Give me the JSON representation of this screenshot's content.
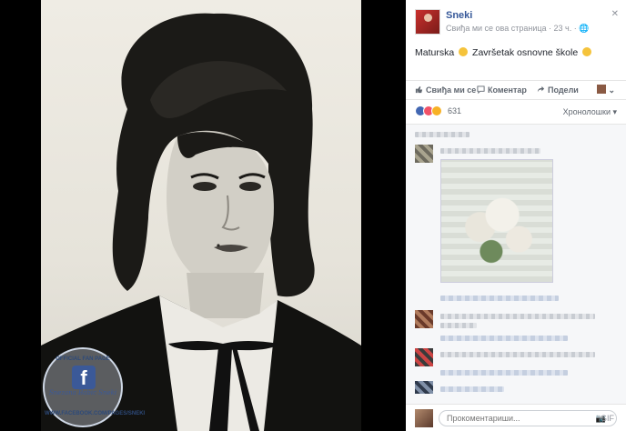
{
  "photo": {
    "watermark_top": "OFFICIAL FAN PAGE",
    "watermark_name": "Snezana Babic Sneki",
    "watermark_url": "WWW.FACEBOOK.COM/PAGES/SNEKI"
  },
  "post": {
    "author": "Sneki",
    "meta": "Свиђа ми се ова страница · 23 ч. · 🌐",
    "text_part1": "Maturska",
    "text_part2": "Završetak osnovne škole"
  },
  "actions": {
    "like": "Свиђа ми се",
    "comment": "Коментар",
    "share": "Подели"
  },
  "reactions": {
    "count": "631",
    "colors": {
      "like": "#4267b2",
      "love": "#f25268",
      "wow": "#f7b125"
    },
    "sort_label": "Хронолошки ▾"
  },
  "composer": {
    "placeholder": "Прокоментариши..."
  },
  "icons": {
    "close": "✕",
    "camera": "📷",
    "gif": "GIF",
    "chevron": "⌄"
  },
  "colors": {
    "accent": "#365899",
    "panel_bg": "#ffffff",
    "comments_bg": "#f6f7f9"
  }
}
